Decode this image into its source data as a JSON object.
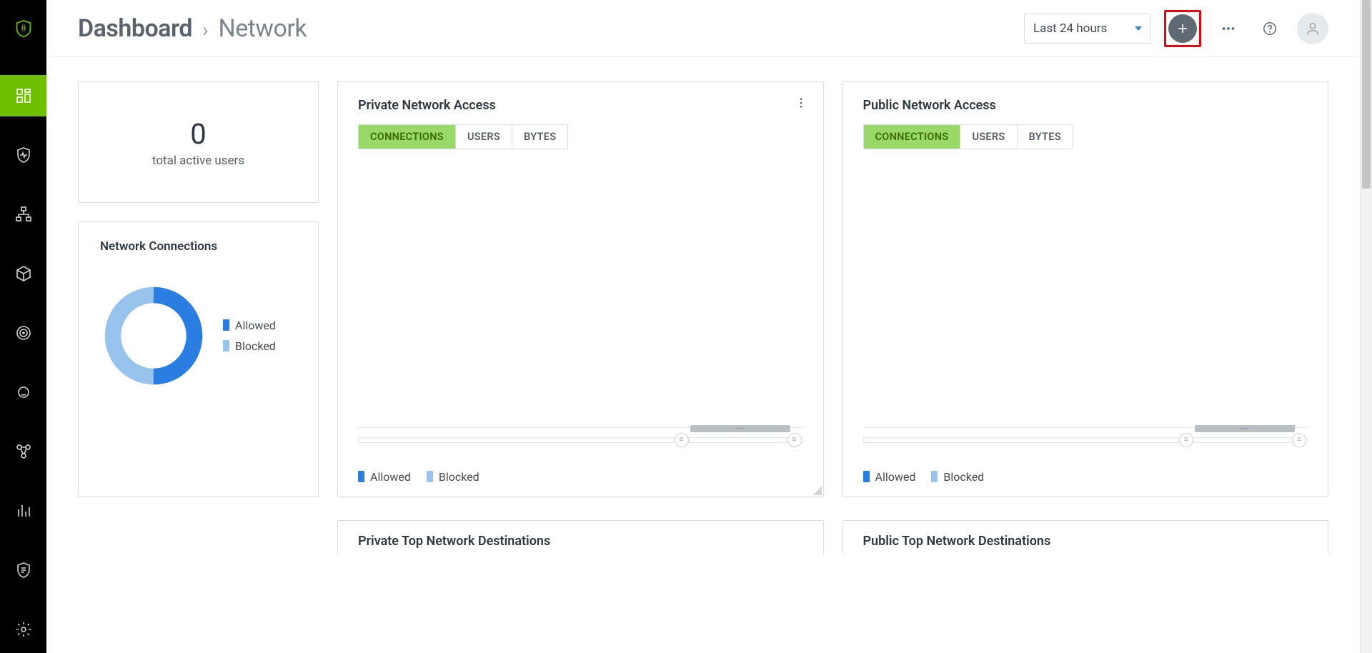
{
  "breadcrumb": {
    "root": "Dashboard",
    "current": "Network"
  },
  "time_picker": {
    "selected": "Last 24 hours"
  },
  "header_actions": {
    "add_tooltip": "Add",
    "more_tooltip": "More",
    "help_tooltip": "Help",
    "avatar_tooltip": "Account"
  },
  "sidebar": {
    "items": [
      {
        "id": "dashboard",
        "active": true
      },
      {
        "id": "security",
        "active": false
      },
      {
        "id": "network",
        "active": false
      },
      {
        "id": "packages",
        "active": false
      },
      {
        "id": "target",
        "active": false
      },
      {
        "id": "identity",
        "active": false
      },
      {
        "id": "integrations",
        "active": false
      },
      {
        "id": "reports",
        "active": false
      },
      {
        "id": "policies",
        "active": false
      },
      {
        "id": "settings",
        "active": false
      }
    ]
  },
  "kpi": {
    "value": "0",
    "label": "total active users"
  },
  "donut_card": {
    "title": "Network Connections",
    "legend": {
      "allowed": "Allowed",
      "blocked": "Blocked"
    }
  },
  "panels": {
    "private": {
      "title": "Private Network Access",
      "tabs": [
        "CONNECTIONS",
        "USERS",
        "BYTES"
      ],
      "active_tab": "CONNECTIONS",
      "legend": {
        "allowed": "Allowed",
        "blocked": "Blocked"
      }
    },
    "public": {
      "title": "Public Network Access",
      "tabs": [
        "CONNECTIONS",
        "USERS",
        "BYTES"
      ],
      "active_tab": "CONNECTIONS",
      "legend": {
        "allowed": "Allowed",
        "blocked": "Blocked"
      }
    }
  },
  "bottom": {
    "private_dest": {
      "title": "Private Top Network Destinations"
    },
    "public_dest": {
      "title": "Public Top Network Destinations"
    }
  },
  "chart_data": [
    {
      "id": "network-connections-donut",
      "type": "pie",
      "title": "Network Connections",
      "series": [
        {
          "name": "Allowed",
          "value": 50,
          "color": "#2a7de1"
        },
        {
          "name": "Blocked",
          "value": 50,
          "color": "#97c3ec"
        }
      ],
      "note": "No data; equal placeholder arcs"
    },
    {
      "id": "private-network-access",
      "type": "bar",
      "title": "Private Network Access",
      "series": [
        {
          "name": "Allowed",
          "values": []
        },
        {
          "name": "Blocked",
          "values": []
        }
      ],
      "categories": [],
      "note": "Empty in screenshot"
    },
    {
      "id": "public-network-access",
      "type": "bar",
      "title": "Public Network Access",
      "series": [
        {
          "name": "Allowed",
          "values": []
        },
        {
          "name": "Blocked",
          "values": []
        }
      ],
      "categories": [],
      "note": "Empty in screenshot"
    }
  ],
  "colors": {
    "accent_green": "#6dbf00",
    "tab_active_bg": "#98d96a",
    "allowed": "#2a7de1",
    "blocked": "#97c3ec",
    "highlight": "#e30613"
  }
}
